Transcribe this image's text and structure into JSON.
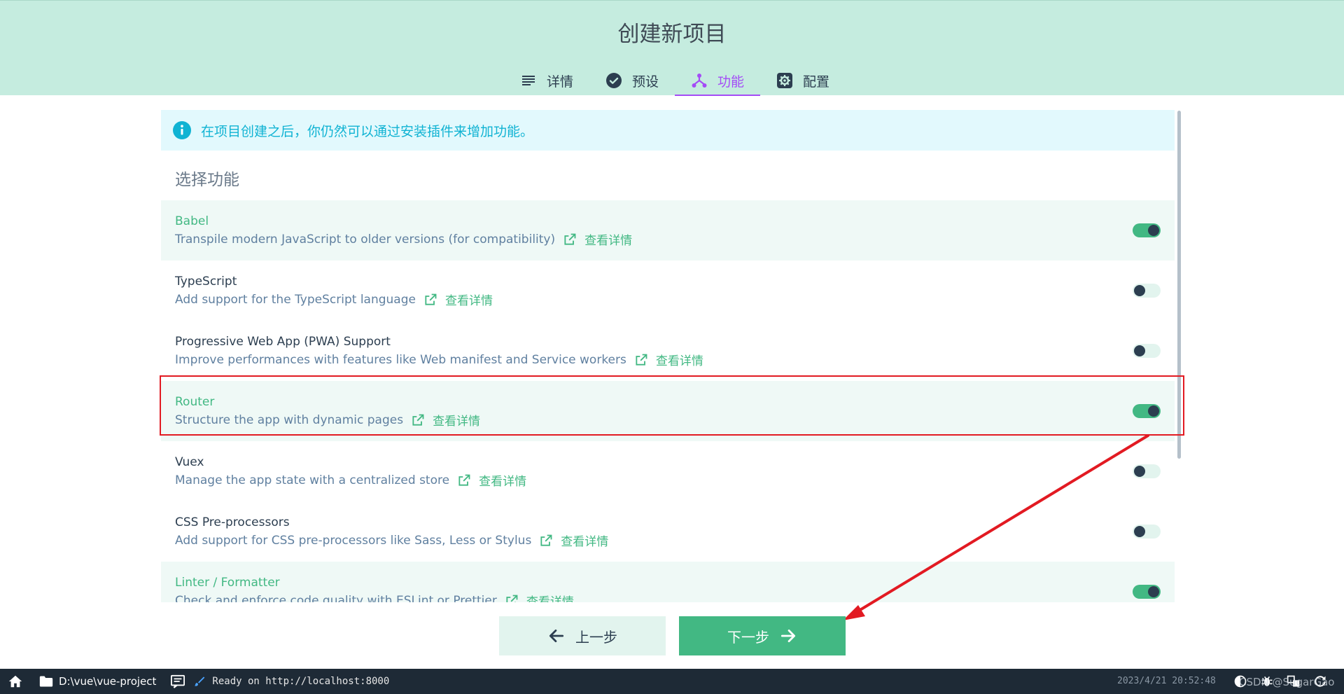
{
  "header": {
    "title": "创建新项目",
    "tabs": [
      {
        "label": "详情",
        "icon": "list-icon"
      },
      {
        "label": "预设",
        "icon": "check-circle-icon"
      },
      {
        "label": "功能",
        "icon": "branch-icon",
        "active": true
      },
      {
        "label": "配置",
        "icon": "gear-icon"
      }
    ]
  },
  "info": {
    "text": "在项目创建之后，你仍然可以通过安装插件来增加功能。",
    "icon": "info-icon"
  },
  "section_title": "选择功能",
  "more_label": "查看详情",
  "features": [
    {
      "name": "Babel",
      "desc": "Transpile modern JavaScript to older versions (for compatibility)",
      "enabled": true
    },
    {
      "name": "TypeScript",
      "desc": "Add support for the TypeScript language",
      "enabled": false
    },
    {
      "name": "Progressive Web App (PWA) Support",
      "desc": "Improve performances with features like Web manifest and Service workers",
      "enabled": false
    },
    {
      "name": "Router",
      "desc": "Structure the app with dynamic pages",
      "enabled": true
    },
    {
      "name": "Vuex",
      "desc": "Manage the app state with a centralized store",
      "enabled": false
    },
    {
      "name": "CSS Pre-processors",
      "desc": "Add support for CSS pre-processors like Sass, Less or Stylus",
      "enabled": false
    },
    {
      "name": "Linter / Formatter",
      "desc": "Check and enforce code quality with ESLint or Prettier",
      "enabled": true
    }
  ],
  "buttons": {
    "prev": "上一步",
    "next": "下一步"
  },
  "statusbar": {
    "path": "D:\\vue\\vue-project",
    "message": "Ready on http://localhost:8000",
    "datetime": "2023/4/21  20:52:48",
    "watermark": "CSDN @SugarGao"
  },
  "colors": {
    "header_bg": "#c5ecdf",
    "accent_green": "#42b883",
    "tab_active": "#a44cf6",
    "info_text": "#10b3d3",
    "annotation_red": "#e21a22",
    "statusbar_bg": "#1e2a36"
  }
}
